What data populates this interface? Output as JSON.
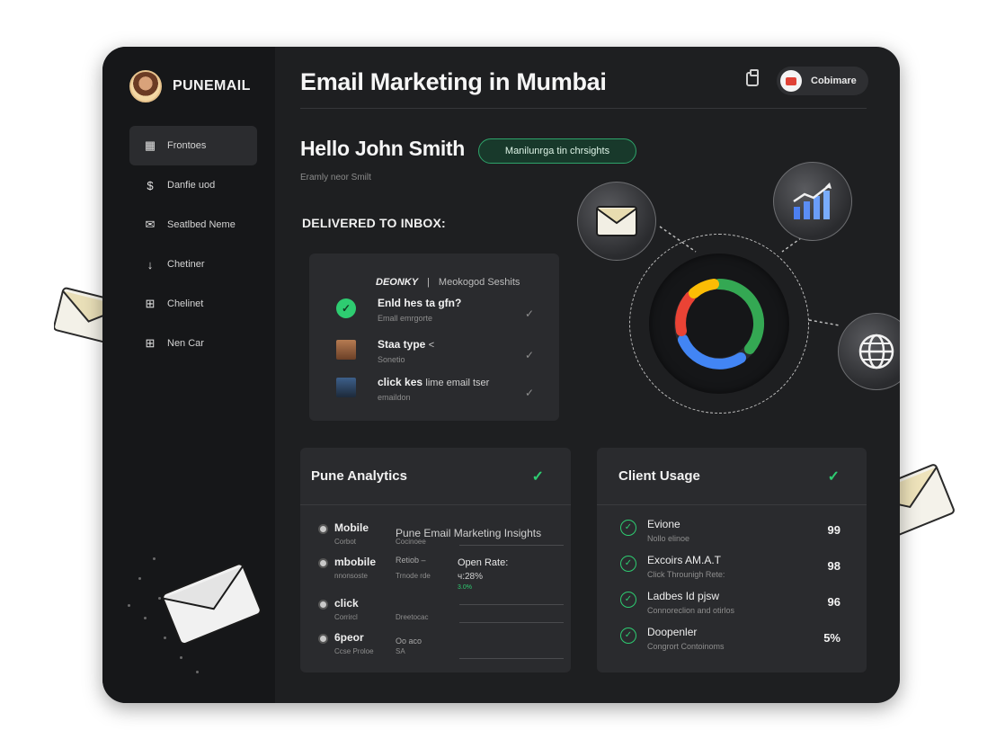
{
  "brand": {
    "name": "PUNEMAIL"
  },
  "sidebar": {
    "items": [
      {
        "label": "Frontoes",
        "icon": "grid-icon"
      },
      {
        "label": "Danfie uod",
        "icon": "dollar-icon"
      },
      {
        "label": "Seatlbed Neme",
        "icon": "mail-icon"
      },
      {
        "label": "Chetiner",
        "icon": "download-arrow-icon"
      },
      {
        "label": "Chelinet",
        "icon": "gift-icon"
      },
      {
        "label": "Nen Car",
        "icon": "gift-icon"
      }
    ]
  },
  "header": {
    "title": "Email Marketing in Mumbai",
    "profile_label": "Cobimare"
  },
  "greeting": {
    "hello": "Hello John Smith",
    "insights_button": "Manilunrga tin chrsights",
    "subline": "Eramly neor Smilt"
  },
  "inbox": {
    "section_label": "DELIVERED TO INBOX:",
    "header_brand": "DEONKY",
    "header_sep": "|",
    "header_text": "Meokogod Seshits",
    "rows": [
      {
        "title": "Enld hes ta gfn?",
        "title_rest": "",
        "sub": "Emall emrgorte"
      },
      {
        "title": "Staa type",
        "title_rest": "<",
        "sub": "Sonetio"
      },
      {
        "title": "click kes",
        "title_rest": "lime email tser",
        "sub": "emaildon"
      }
    ]
  },
  "analytics": {
    "title": "Pune Analytics",
    "insight_title": "Pune Email Marketing Insights",
    "open_rate_label": "Open Rate:",
    "open_rate_value": "ч:28%",
    "open_rate_small": "3.0%",
    "rows": [
      {
        "label": "Mobile",
        "sub": "Corbot",
        "mid": "",
        "mid2": "Cocinoee"
      },
      {
        "label": "mbobile",
        "sub": "nnonsoste",
        "mid": "Retiob –",
        "mid2": "Trnode rde"
      },
      {
        "label": "click",
        "sub": "Corrircl",
        "mid": "",
        "mid2": "Dreetocac"
      },
      {
        "label": "6peor",
        "sub": "Ccse Proloe",
        "mid": "Oo aco",
        "mid2": "SA"
      }
    ]
  },
  "client_usage": {
    "title": "Client Usage",
    "rows": [
      {
        "title": "Evione",
        "sub": "Nollo elinoe",
        "value": "99"
      },
      {
        "title": "Excoirs AM.A.T",
        "sub": "Click Throunigh Rete:",
        "value": "98"
      },
      {
        "title": "Ladbes Id pjsw",
        "sub": "Connoreclion and otirlos",
        "value": "96"
      },
      {
        "title": "Doopenler",
        "sub": "Congrort Contoinoms",
        "value": "5%"
      }
    ]
  },
  "colors": {
    "accent_green": "#2ecc71",
    "ring_blue": "#4285f4",
    "ring_red": "#ea4335",
    "ring_yellow": "#fbbc05",
    "ring_green": "#34a853"
  }
}
